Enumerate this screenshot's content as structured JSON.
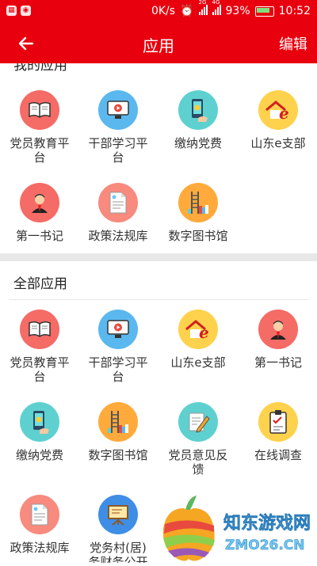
{
  "status": {
    "speed": "0K/s",
    "net1": "2G",
    "net2": "4G",
    "battery": "93%",
    "time": "10:52"
  },
  "topbar": {
    "title": "应用",
    "edit_label": "编辑"
  },
  "my_apps": {
    "heading": "我的应用",
    "items": [
      {
        "label": "党员教育平台",
        "icon": "book-icon"
      },
      {
        "label": "干部学习平台",
        "icon": "video-play-icon"
      },
      {
        "label": "缴纳党费",
        "icon": "mobile-pay-icon"
      },
      {
        "label": "山东e支部",
        "icon": "e-branch-house-icon"
      },
      {
        "label": "第一书记",
        "icon": "secretary-person-icon"
      },
      {
        "label": "政策法规库",
        "icon": "document-icon"
      },
      {
        "label": "数字图书馆",
        "icon": "library-ladder-icon"
      }
    ]
  },
  "all_apps": {
    "heading": "全部应用",
    "items": [
      {
        "label": "党员教育平台",
        "icon": "book-icon"
      },
      {
        "label": "干部学习平台",
        "icon": "video-play-icon"
      },
      {
        "label": "山东e支部",
        "icon": "e-branch-house-icon"
      },
      {
        "label": "第一书记",
        "icon": "secretary-person-icon"
      },
      {
        "label": "缴纳党费",
        "icon": "mobile-pay-icon"
      },
      {
        "label": "数字图书馆",
        "icon": "library-ladder-icon"
      },
      {
        "label": "党员意见反馈",
        "icon": "feedback-pen-icon"
      },
      {
        "label": "在线调查",
        "icon": "survey-clipboard-icon"
      },
      {
        "label": "政策法规库",
        "icon": "document-icon"
      },
      {
        "label": "党务村(居)务财务公开",
        "icon": "presentation-board-icon"
      }
    ]
  },
  "watermark": {
    "line1": "知东游戏网",
    "line2": "ZMO26.CN"
  }
}
